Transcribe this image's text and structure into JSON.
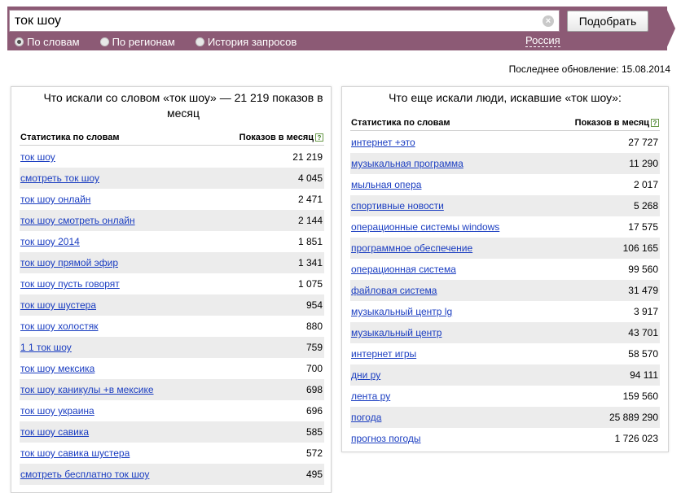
{
  "search": {
    "query": "ток шоу",
    "submit_label": "Подобрать",
    "modes": [
      "По словам",
      "По регионам",
      "История запросов"
    ],
    "region": "Россия"
  },
  "updated_text": "Последнее обновление: 15.08.2014",
  "left_panel": {
    "title": "Что искали со словом «ток шоу» — 21 219 показов в месяц",
    "col_keyword": "Статистика по словам",
    "col_count": "Показов в месяц",
    "help": "?",
    "rows": [
      {
        "kw": "ток шоу",
        "num": "21 219"
      },
      {
        "kw": "смотреть ток шоу",
        "num": "4 045"
      },
      {
        "kw": "ток шоу онлайн",
        "num": "2 471"
      },
      {
        "kw": "ток шоу смотреть онлайн",
        "num": "2 144"
      },
      {
        "kw": "ток шоу 2014",
        "num": "1 851"
      },
      {
        "kw": "ток шоу прямой эфир",
        "num": "1 341"
      },
      {
        "kw": "ток шоу пусть говорят",
        "num": "1 075"
      },
      {
        "kw": "ток шоу шустера",
        "num": "954"
      },
      {
        "kw": "ток шоу холостяк",
        "num": "880"
      },
      {
        "kw": "1 1 ток шоу",
        "num": "759"
      },
      {
        "kw": "ток шоу мексика",
        "num": "700"
      },
      {
        "kw": "ток шоу каникулы +в мексике",
        "num": "698"
      },
      {
        "kw": "ток шоу украина",
        "num": "696"
      },
      {
        "kw": "ток шоу савика",
        "num": "585"
      },
      {
        "kw": "ток шоу савика шустера",
        "num": "572"
      },
      {
        "kw": "смотреть бесплатно ток шоу",
        "num": "495"
      }
    ]
  },
  "right_panel": {
    "title": "Что еще искали люди, искавшие «ток шоу»:",
    "col_keyword": "Статистика по словам",
    "col_count": "Показов в месяц",
    "help": "?",
    "rows": [
      {
        "kw": "интернет +это",
        "num": "27 727"
      },
      {
        "kw": "музыкальная программа",
        "num": "11 290"
      },
      {
        "kw": "мыльная опера",
        "num": "2 017"
      },
      {
        "kw": "спортивные новости",
        "num": "5 268"
      },
      {
        "kw": "операционные системы windows",
        "num": "17 575"
      },
      {
        "kw": "программное обеспечение",
        "num": "106 165"
      },
      {
        "kw": "операционная система",
        "num": "99 560"
      },
      {
        "kw": "файловая система",
        "num": "31 479"
      },
      {
        "kw": "музыкальный центр lg",
        "num": "3 917"
      },
      {
        "kw": "музыкальный центр",
        "num": "43 701"
      },
      {
        "kw": "интернет игры",
        "num": "58 570"
      },
      {
        "kw": "дни ру",
        "num": "94 111"
      },
      {
        "kw": "лента ру",
        "num": "159 560"
      },
      {
        "kw": "погода",
        "num": "25 889 290"
      },
      {
        "kw": "прогноз погоды",
        "num": "1 726 023"
      }
    ]
  },
  "colors": {
    "bar": "#8c5a75",
    "link": "#1a3dc1",
    "row_alt": "#ececec"
  }
}
